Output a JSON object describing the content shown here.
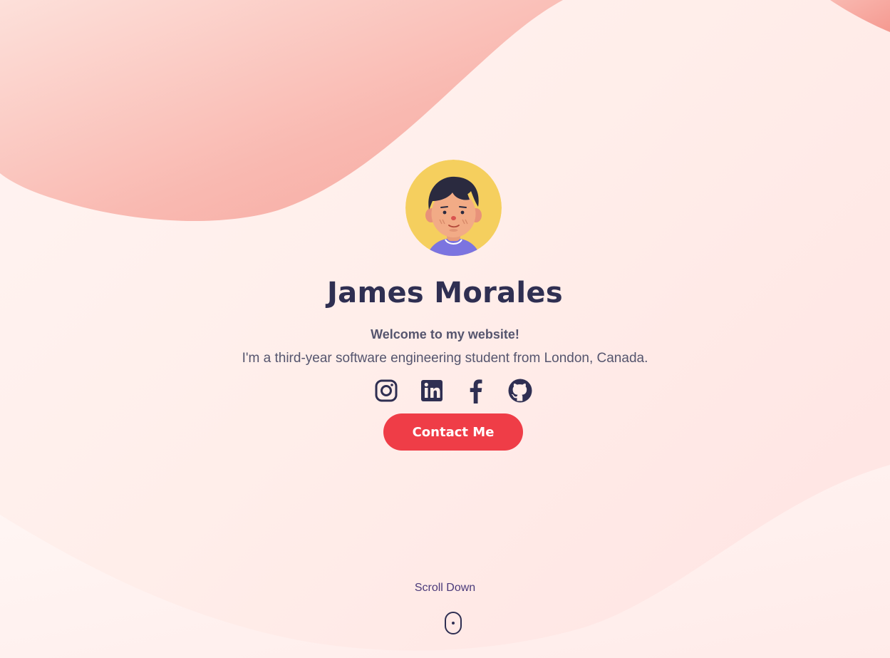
{
  "profile": {
    "name": "James Morales",
    "welcome": "Welcome to my website!",
    "intro": "I'm a third-year software engineering student from London, Canada.",
    "avatar_icon": "avatar-illustration"
  },
  "socials": [
    {
      "icon": "instagram-icon"
    },
    {
      "icon": "linkedin-icon"
    },
    {
      "icon": "facebook-icon"
    },
    {
      "icon": "github-icon"
    }
  ],
  "cta": {
    "label": "Contact Me"
  },
  "scroll": {
    "label": "Scroll Down",
    "icon": "mouse-scroll-icon"
  },
  "colors": {
    "accent": "#ef3d47",
    "heading": "#2f2f52",
    "text": "#55556e",
    "scroll_text": "#4a3a7a",
    "wave": "#f8aba2",
    "avatar_bg": "#f5cf5e"
  }
}
